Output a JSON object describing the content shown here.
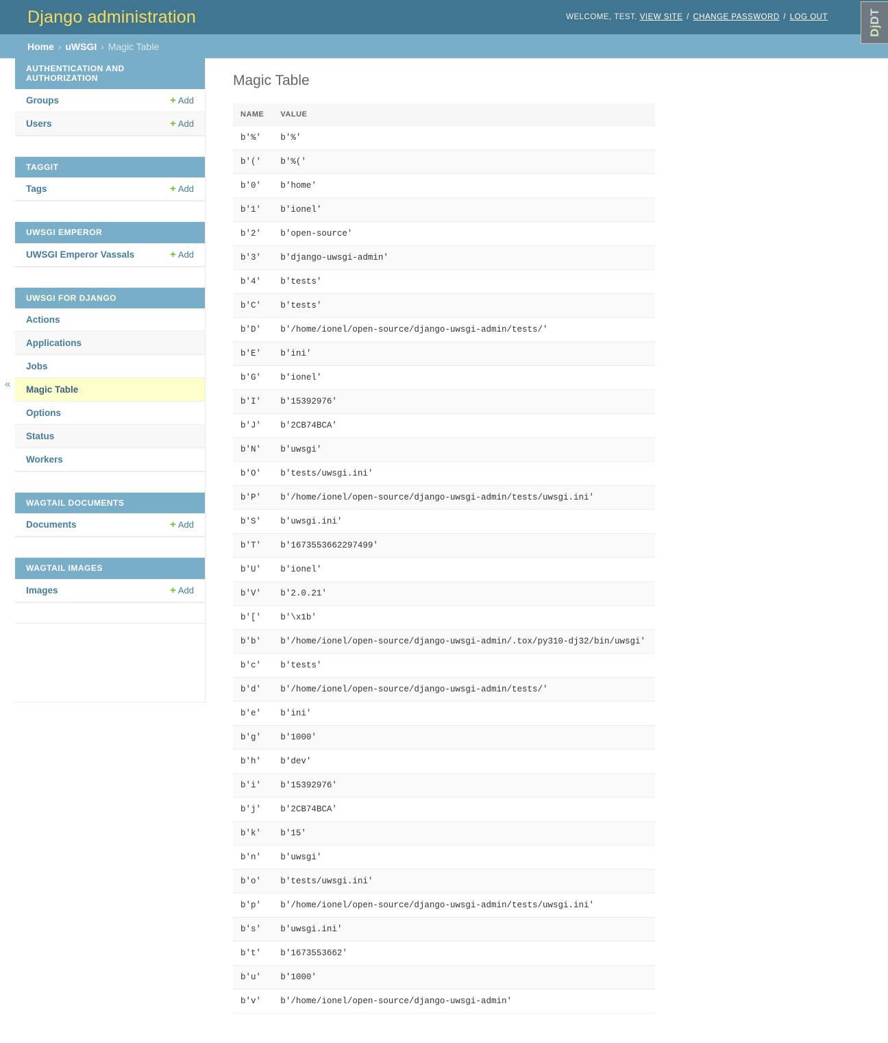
{
  "header": {
    "site_title": "Django administration",
    "welcome": "WELCOME, TEST.",
    "view_site": "VIEW SITE",
    "change_password": "CHANGE PASSWORD",
    "log_out": "LOG OUT",
    "separator": "/"
  },
  "breadcrumbs": {
    "home": "Home",
    "sep": "›",
    "app": "uWSGI",
    "current": "Magic Table"
  },
  "debug_toolbar": {
    "handle_dj": "Dj",
    "handle_dt": "DT"
  },
  "sidebar": {
    "toggle_icon": "«",
    "add_label": "Add",
    "plus_icon": "+",
    "groups": [
      {
        "title": "AUTHENTICATION AND AUTHORIZATION",
        "items": [
          {
            "label": "Groups",
            "add": true
          },
          {
            "label": "Users",
            "add": true
          }
        ]
      },
      {
        "title": "TAGGIT",
        "items": [
          {
            "label": "Tags",
            "add": true
          }
        ]
      },
      {
        "title": "UWSGI EMPEROR",
        "items": [
          {
            "label": "UWSGI Emperor Vassals",
            "add": true
          }
        ]
      },
      {
        "title": "UWSGI FOR DJANGO",
        "highlight_caption": true,
        "items": [
          {
            "label": "Actions",
            "add": false
          },
          {
            "label": "Applications",
            "add": false
          },
          {
            "label": "Jobs",
            "add": false
          },
          {
            "label": "Magic Table",
            "add": false,
            "current": true
          },
          {
            "label": "Options",
            "add": false
          },
          {
            "label": "Status",
            "add": false
          },
          {
            "label": "Workers",
            "add": false
          }
        ]
      },
      {
        "title": "WAGTAIL DOCUMENTS",
        "items": [
          {
            "label": "Documents",
            "add": true
          }
        ]
      },
      {
        "title": "WAGTAIL IMAGES",
        "items": [
          {
            "label": "Images",
            "add": true
          }
        ]
      }
    ]
  },
  "content": {
    "page_title": "Magic Table",
    "table": {
      "columns": [
        "NAME",
        "VALUE"
      ],
      "rows": [
        [
          "b'%'",
          "b'%'"
        ],
        [
          "b'('",
          "b'%('"
        ],
        [
          "b'0'",
          "b'home'"
        ],
        [
          "b'1'",
          "b'ionel'"
        ],
        [
          "b'2'",
          "b'open-source'"
        ],
        [
          "b'3'",
          "b'django-uwsgi-admin'"
        ],
        [
          "b'4'",
          "b'tests'"
        ],
        [
          "b'C'",
          "b'tests'"
        ],
        [
          "b'D'",
          "b'/home/ionel/open-source/django-uwsgi-admin/tests/'"
        ],
        [
          "b'E'",
          "b'ini'"
        ],
        [
          "b'G'",
          "b'ionel'"
        ],
        [
          "b'I'",
          "b'15392976'"
        ],
        [
          "b'J'",
          "b'2CB74BCA'"
        ],
        [
          "b'N'",
          "b'uwsgi'"
        ],
        [
          "b'O'",
          "b'tests/uwsgi.ini'"
        ],
        [
          "b'P'",
          "b'/home/ionel/open-source/django-uwsgi-admin/tests/uwsgi.ini'"
        ],
        [
          "b'S'",
          "b'uwsgi.ini'"
        ],
        [
          "b'T'",
          "b'1673553662297499'"
        ],
        [
          "b'U'",
          "b'ionel'"
        ],
        [
          "b'V'",
          "b'2.0.21'"
        ],
        [
          "b'['",
          "b'\\x1b'"
        ],
        [
          "b'b'",
          "b'/home/ionel/open-source/django-uwsgi-admin/.tox/py310-dj32/bin/uwsgi'"
        ],
        [
          "b'c'",
          "b'tests'"
        ],
        [
          "b'd'",
          "b'/home/ionel/open-source/django-uwsgi-admin/tests/'"
        ],
        [
          "b'e'",
          "b'ini'"
        ],
        [
          "b'g'",
          "b'1000'"
        ],
        [
          "b'h'",
          "b'dev'"
        ],
        [
          "b'i'",
          "b'15392976'"
        ],
        [
          "b'j'",
          "b'2CB74BCA'"
        ],
        [
          "b'k'",
          "b'15'"
        ],
        [
          "b'n'",
          "b'uwsgi'"
        ],
        [
          "b'o'",
          "b'tests/uwsgi.ini'"
        ],
        [
          "b'p'",
          "b'/home/ionel/open-source/django-uwsgi-admin/tests/uwsgi.ini'"
        ],
        [
          "b's'",
          "b'uwsgi.ini'"
        ],
        [
          "b't'",
          "b'1673553662'"
        ],
        [
          "b'u'",
          "b'1000'"
        ],
        [
          "b'v'",
          "b'/home/ionel/open-source/django-uwsgi-admin'"
        ]
      ]
    }
  },
  "colors": {
    "header_bg": "#417690",
    "breadcrumb_bg": "#79aec8",
    "brand_text": "#f5dd5d",
    "link": "#447e9b",
    "add_green": "#70bf2b",
    "current_highlight": "#ffffcc"
  }
}
